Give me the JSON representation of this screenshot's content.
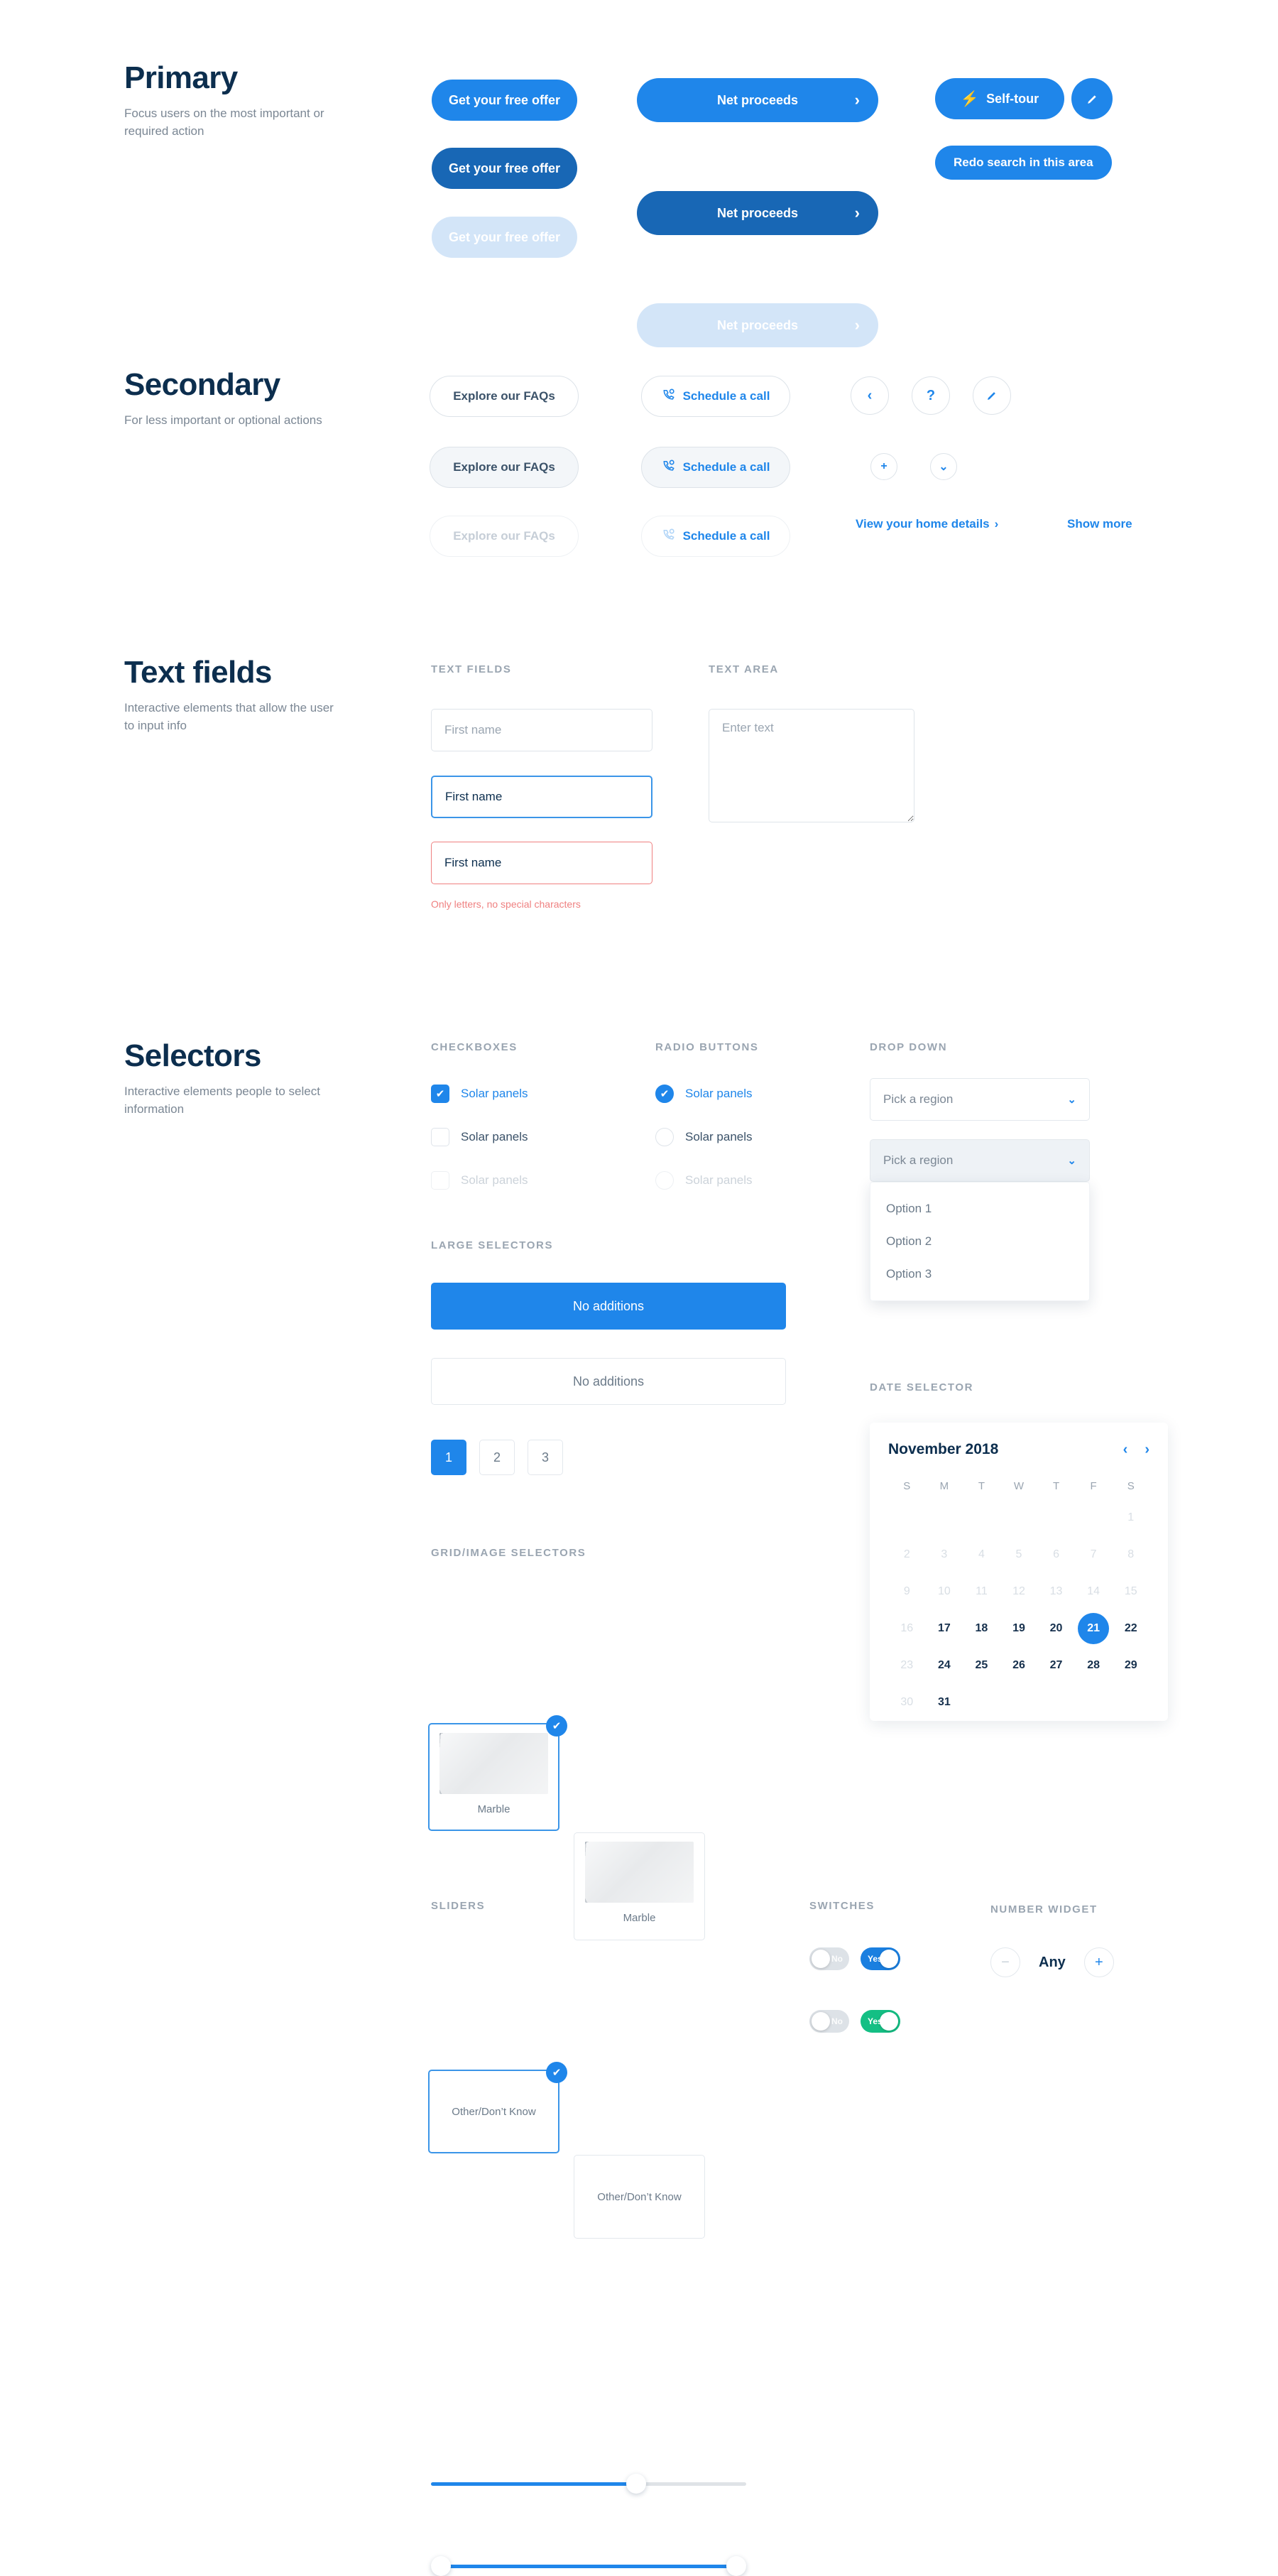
{
  "sections": {
    "primary": {
      "title": "Primary",
      "description": "Focus users on the most important or required action",
      "buttons": {
        "free_offer_default": "Get your free offer",
        "free_offer_hover": "Get your free offer",
        "free_offer_disabled": "Get your free offer",
        "net_proceeds_default": "Net proceeds",
        "net_proceeds_hover": "Net proceeds",
        "net_proceeds_disabled": "Net proceeds",
        "self_tour": "Self-tour",
        "redo_search": "Redo search in this area"
      },
      "chevron": "›"
    },
    "secondary": {
      "title": "Secondary",
      "description": "For less important or optional actions",
      "buttons": {
        "faq_default": "Explore our FAQs",
        "faq_hover": "Explore our FAQs",
        "faq_disabled": "Explore our FAQs",
        "call_default": "Schedule a call",
        "call_hover": "Schedule a call",
        "call_disabled": "Schedule a call"
      },
      "icon_buttons": {
        "back": "‹",
        "help": "?",
        "plus": "+",
        "caret_down": "⌄"
      },
      "links": {
        "home_details": "View your home details",
        "home_details_chevron": "›",
        "show_more": "Show more"
      }
    },
    "text_fields": {
      "title": "Text fields",
      "description": "Interactive elements that allow the user to input info",
      "label_fields": "TEXT FIELDS",
      "label_area": "TEXT AREA",
      "field_placeholder": "First name",
      "field_focus_value": "First name",
      "field_error_value": "First name",
      "error_message": "Only letters, no special characters",
      "textarea_placeholder": "Enter text"
    },
    "selectors": {
      "title": "Selectors",
      "description": "Interactive elements people to select information",
      "label_checkboxes": "CHECKBOXES",
      "label_radios": "RADIO BUTTONS",
      "label_dropdown": "DROP DOWN",
      "label_large": "LARGE SELECTORS",
      "label_grid": "GRID/IMAGE SELECTORS",
      "label_date": "DATE SELECTOR",
      "label_sliders": "SLIDERS",
      "label_switches": "SWITCHES",
      "label_number": "NUMBER WIDGET",
      "checkboxes": [
        {
          "label": "Solar panels",
          "checked": true,
          "disabled": false
        },
        {
          "label": "Solar panels",
          "checked": false,
          "disabled": false
        },
        {
          "label": "Solar panels",
          "checked": false,
          "disabled": true
        }
      ],
      "radios": [
        {
          "label": "Solar panels",
          "checked": true,
          "disabled": false
        },
        {
          "label": "Solar panels",
          "checked": false,
          "disabled": false
        },
        {
          "label": "Solar panels",
          "checked": false,
          "disabled": true
        }
      ],
      "dropdown": {
        "value_default": "Pick a region",
        "value_open": "Pick a region",
        "caret": "⌄",
        "options": [
          "Option 1",
          "Option 2",
          "Option 3"
        ]
      },
      "large_selectors": {
        "selected": "No additions",
        "unselected": "No additions"
      },
      "pagination": [
        "1",
        "2",
        "3"
      ],
      "grid_cards": [
        {
          "caption": "Marble",
          "selected": true,
          "has_image": true
        },
        {
          "caption": "Marble",
          "selected": false,
          "has_image": true
        },
        {
          "caption": "Other/Don’t Know",
          "selected": true,
          "has_image": false
        },
        {
          "caption": "Other/Don’t Know",
          "selected": false,
          "has_image": false
        }
      ],
      "badge_check": "✔",
      "calendar": {
        "month_title": "November 2018",
        "prev": "‹",
        "next": "›",
        "day_initials": [
          "S",
          "M",
          "T",
          "W",
          "T",
          "F",
          "S"
        ],
        "selected_day": 21,
        "weeks": [
          [
            null,
            null,
            null,
            null,
            null,
            null,
            1
          ],
          [
            2,
            3,
            4,
            5,
            6,
            7,
            8
          ],
          [
            9,
            10,
            11,
            12,
            13,
            14,
            15
          ],
          [
            16,
            17,
            18,
            19,
            20,
            21,
            22
          ],
          [
            23,
            24,
            25,
            26,
            27,
            28,
            29
          ],
          [
            30,
            31,
            null,
            null,
            null,
            null,
            null
          ]
        ],
        "muted_days": [
          1,
          2,
          3,
          4,
          5,
          6,
          7,
          8,
          9,
          10,
          11,
          12,
          13,
          14,
          15,
          16,
          23,
          30
        ]
      },
      "sliders": [
        {
          "type": "single",
          "fill_percent": 66
        },
        {
          "type": "range",
          "start_percent": 0,
          "end_percent": 100
        }
      ],
      "switches": [
        {
          "off_label": "No",
          "on_label": "Yes",
          "on_color": "#1a7fe0"
        },
        {
          "off_label": "No",
          "on_label": "Yes",
          "on_color": "#14bf84"
        }
      ],
      "number_widget": {
        "minus": "−",
        "value": "Any",
        "plus": "+"
      }
    }
  },
  "colors": {
    "primary_blue": "#1f86ea",
    "primary_blue_hover": "#1867b5",
    "primary_disabled": "#d3e5f8",
    "heading_navy": "#0c2e4e",
    "muted_gray": "#7b8794",
    "label_gray": "#9aa5b1",
    "error_red": "#ef8080",
    "success_green": "#14bf84",
    "border_gray": "#dfe4ea"
  }
}
